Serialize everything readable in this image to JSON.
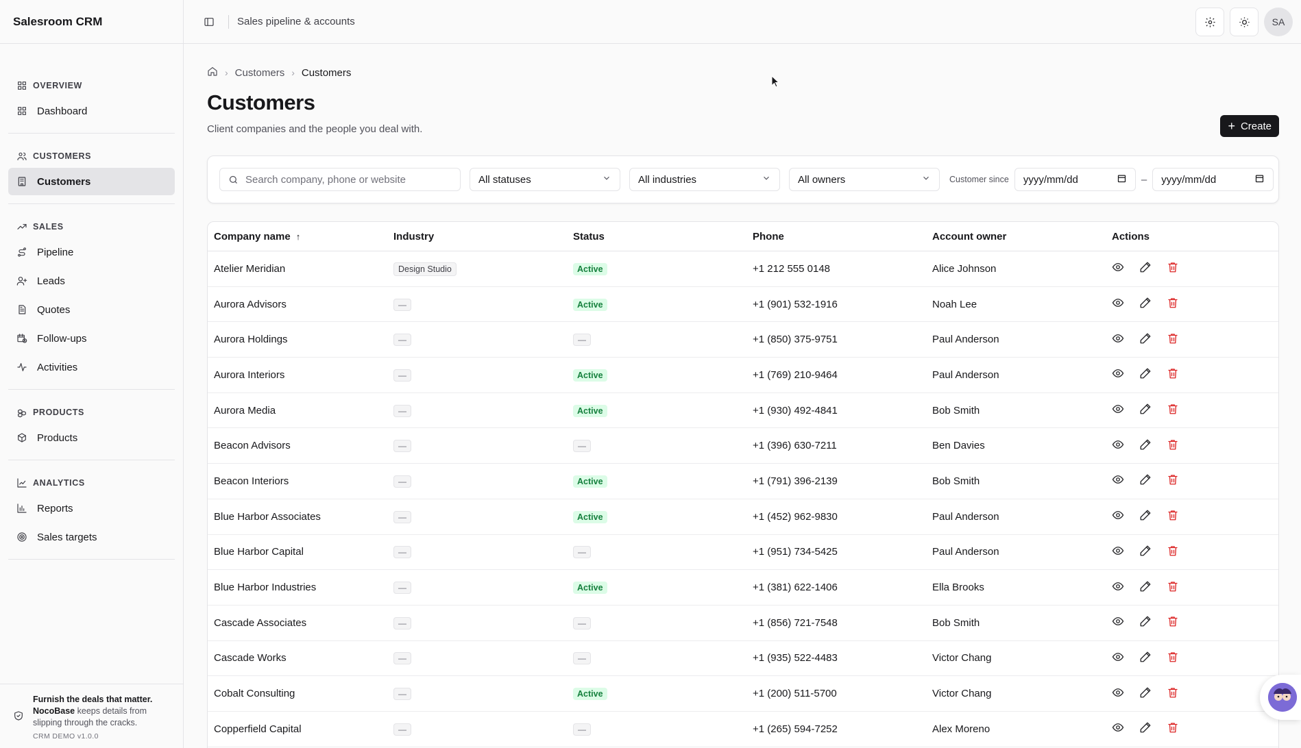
{
  "app": {
    "brand": "Salesroom CRM",
    "page_header": "Sales pipeline & accounts",
    "avatar_initials": "SA"
  },
  "nav": {
    "groups": [
      {
        "label": "OVERVIEW",
        "icon": "grid-icon",
        "items": [
          {
            "label": "Dashboard",
            "icon": "grid-icon"
          }
        ]
      },
      {
        "label": "CUSTOMERS",
        "icon": "users-icon",
        "items": [
          {
            "label": "Customers",
            "icon": "building-icon",
            "active": true
          }
        ]
      },
      {
        "label": "SALES",
        "icon": "trend-icon",
        "items": [
          {
            "label": "Pipeline",
            "icon": "route-icon"
          },
          {
            "label": "Leads",
            "icon": "user-plus-icon"
          },
          {
            "label": "Quotes",
            "icon": "file-icon"
          },
          {
            "label": "Follow-ups",
            "icon": "calendar-clock-icon"
          },
          {
            "label": "Activities",
            "icon": "activity-icon"
          }
        ]
      },
      {
        "label": "PRODUCTS",
        "icon": "boxes-icon",
        "items": [
          {
            "label": "Products",
            "icon": "package-icon"
          }
        ]
      },
      {
        "label": "ANALYTICS",
        "icon": "line-chart-icon",
        "items": [
          {
            "label": "Reports",
            "icon": "bar-chart-icon"
          },
          {
            "label": "Sales targets",
            "icon": "target-icon"
          }
        ]
      }
    ]
  },
  "promo": {
    "headline": "Furnish the deals that matter.",
    "brand": "NocoBase",
    "body": " keeps details from slipping through the cracks.",
    "version": "CRM DEMO v1.0.0"
  },
  "breadcrumb": {
    "items": [
      "Customers",
      "Customers"
    ]
  },
  "page": {
    "title": "Customers",
    "subtitle": "Client companies and the people you deal with.",
    "create_label": "Create"
  },
  "filters": {
    "search_placeholder": "Search company, phone or website",
    "status": "All statuses",
    "industry": "All industries",
    "owner": "All owners",
    "since_label": "Customer since",
    "date_from": "yyyy/mm/dd",
    "date_to": "yyyy/mm/dd",
    "range_separator": "–"
  },
  "table": {
    "columns": [
      "Company name",
      "Industry",
      "Status",
      "Phone",
      "Account owner",
      "Actions"
    ],
    "sort_indicator": "↑",
    "rows": [
      {
        "company": "Atelier Meridian",
        "industry": "Design Studio",
        "status": "Active",
        "phone": "+1 212 555 0148",
        "owner": "Alice Johnson"
      },
      {
        "company": "Aurora Advisors",
        "industry": "—",
        "status": "Active",
        "phone": "+1 (901) 532-1916",
        "owner": "Noah Lee"
      },
      {
        "company": "Aurora Holdings",
        "industry": "—",
        "status": "—",
        "phone": "+1 (850) 375-9751",
        "owner": "Paul Anderson"
      },
      {
        "company": "Aurora Interiors",
        "industry": "—",
        "status": "Active",
        "phone": "+1 (769) 210-9464",
        "owner": "Paul Anderson"
      },
      {
        "company": "Aurora Media",
        "industry": "—",
        "status": "Active",
        "phone": "+1 (930) 492-4841",
        "owner": "Bob Smith"
      },
      {
        "company": "Beacon Advisors",
        "industry": "—",
        "status": "—",
        "phone": "+1 (396) 630-7211",
        "owner": "Ben Davies"
      },
      {
        "company": "Beacon Interiors",
        "industry": "—",
        "status": "Active",
        "phone": "+1 (791) 396-2139",
        "owner": "Bob Smith"
      },
      {
        "company": "Blue Harbor Associates",
        "industry": "—",
        "status": "Active",
        "phone": "+1 (452) 962-9830",
        "owner": "Paul Anderson"
      },
      {
        "company": "Blue Harbor Capital",
        "industry": "—",
        "status": "—",
        "phone": "+1 (951) 734-5425",
        "owner": "Paul Anderson"
      },
      {
        "company": "Blue Harbor Industries",
        "industry": "—",
        "status": "Active",
        "phone": "+1 (381) 622-1406",
        "owner": "Ella Brooks"
      },
      {
        "company": "Cascade Associates",
        "industry": "—",
        "status": "—",
        "phone": "+1 (856) 721-7548",
        "owner": "Bob Smith"
      },
      {
        "company": "Cascade Works",
        "industry": "—",
        "status": "—",
        "phone": "+1 (935) 522-4483",
        "owner": "Victor Chang"
      },
      {
        "company": "Cobalt Consulting",
        "industry": "—",
        "status": "Active",
        "phone": "+1 (200) 511-5700",
        "owner": "Victor Chang"
      },
      {
        "company": "Copperfield Capital",
        "industry": "—",
        "status": "—",
        "phone": "+1 (265) 594-7252",
        "owner": "Alex Moreno"
      }
    ]
  },
  "colors": {
    "accent": "#18181b",
    "active_bg": "#dcfce7",
    "active_text": "#15803d",
    "delete": "#dc2626"
  }
}
